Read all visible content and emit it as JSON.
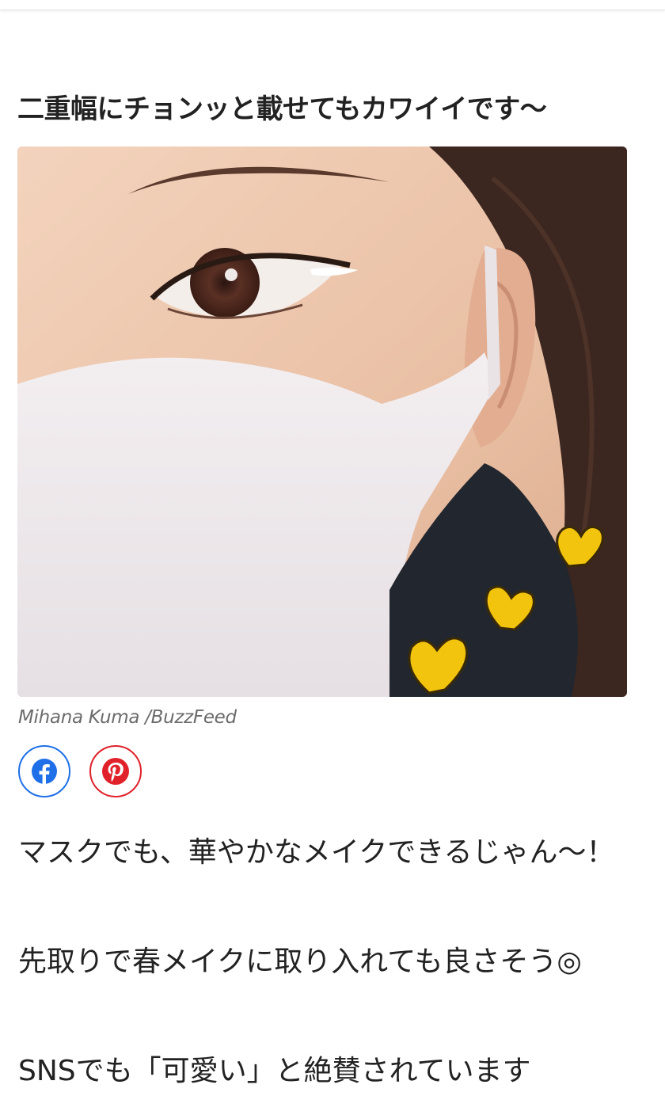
{
  "article": {
    "heading": "二重幅にチョンッと載せてもカワイイです〜",
    "image": {
      "caption": "Mihana Kuma /BuzzFeed"
    },
    "share_buttons": [
      {
        "icon": "facebook-icon",
        "color": "#1f70e8"
      },
      {
        "icon": "pinterest-icon",
        "color": "#e0212a"
      }
    ],
    "paragraphs": [
      "マスクでも、華やかなメイクできるじゃん〜！",
      "先取りで春メイクに取り入れても良さそう◎",
      "SNSでも「可愛い」と絶賛されています"
    ]
  }
}
